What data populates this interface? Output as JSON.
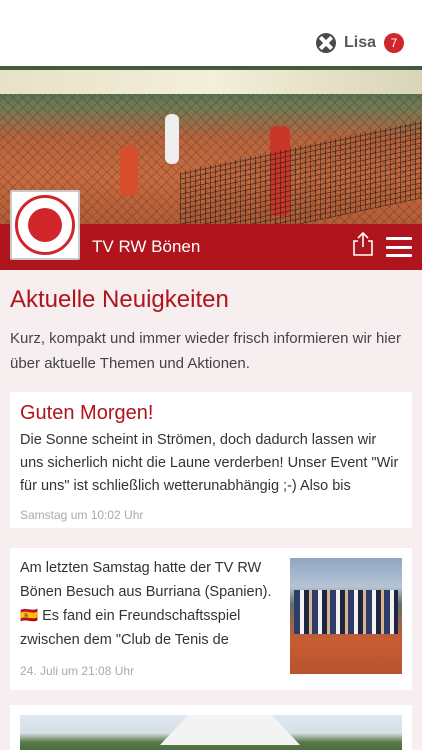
{
  "topbar": {
    "user_name": "Lisa",
    "notification_count": "7"
  },
  "club": {
    "name": "TV RW Bönen",
    "accent_color": "#b0141c"
  },
  "page": {
    "heading": "Aktuelle Neuigkeiten",
    "intro": "Kurz, kompakt und immer wieder frisch informieren wir hier über aktuelle Themen und Aktionen."
  },
  "posts": [
    {
      "title": "Guten Morgen!",
      "text": "Die Sonne scheint in Strömen, doch dadurch lassen wir uns sicherlich nicht die Laune verderben! Unser Event \"Wir für uns\" ist schließlich wetterunabhängig ;-) Also bis nachher! Wir",
      "meta": "Samstag um 10:02 Uhr"
    },
    {
      "text": "Am letzten Samstag hatte der TV RW Bönen Besuch aus Burriana (Spanien). 🇪🇸 Es fand ein Freundschaftsspiel zwischen dem \"Club de Tenis de",
      "meta": "24. Juli um 21:08 Uhr"
    }
  ]
}
